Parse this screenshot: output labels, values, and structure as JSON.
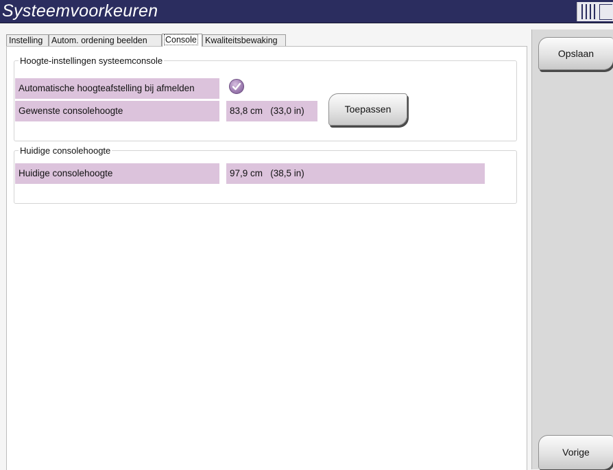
{
  "window": {
    "title": "Systeemvoorkeuren",
    "icon": "window-control-icon"
  },
  "tabs": [
    {
      "label": "Instelling"
    },
    {
      "label": "Autom. ordening beelden"
    },
    {
      "label": "Console"
    },
    {
      "label": "Kwaliteitsbewaking"
    }
  ],
  "active_tab": "Console",
  "height_settings": {
    "legend": "Hoogte-instellingen systeemconsole",
    "auto_label": "Automatische hoogteafstelling bij afmelden",
    "auto_checked": true,
    "desired_label": "Gewenste consolehoogte",
    "desired_value": "83,8 cm   (33,0 in)",
    "apply_label": "Toepassen"
  },
  "current_height": {
    "legend": "Huidige consolehoogte",
    "label": "Huidige consolehoogte",
    "value": "97,9 cm   (38,5 in)"
  },
  "side": {
    "save_label": "Opslaan",
    "back_label": "Vorige"
  },
  "colors": {
    "titlebar": "#2b2d5f",
    "field": "#dcc3dc",
    "panel": "#d9d9d9"
  }
}
